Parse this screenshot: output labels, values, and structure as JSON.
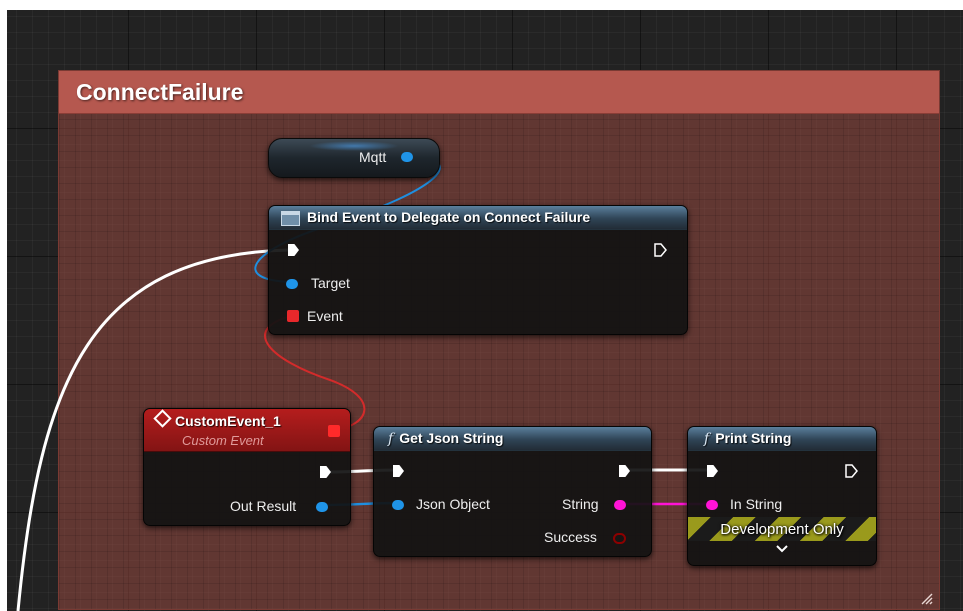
{
  "comment": {
    "title": "ConnectFailure",
    "color": "#b5584f"
  },
  "colors": {
    "exec": "#ffffff",
    "object_pin": "#1f94e8",
    "delegate_pin": "#e8282b",
    "string_pin": "#ff13d6",
    "bool_pin": "#8c0000",
    "function_header": "#2f4456",
    "event_header": "#a31a1a"
  },
  "mqtt_node": {
    "pin_label": "Mqtt",
    "icon": "object-pin-icon"
  },
  "bind_node": {
    "title": "Bind Event to Delegate on Connect Failure",
    "icon": "delegate-icon",
    "pins": {
      "target": "Target",
      "event": "Event"
    }
  },
  "custom_event_node": {
    "title": "CustomEvent_1",
    "subtitle": "Custom Event",
    "icon": "event-diamond-icon",
    "pins": {
      "out_result": "Out Result"
    }
  },
  "get_json_node": {
    "title": "Get Json String",
    "icon": "f",
    "pins": {
      "json_object": "Json Object",
      "string": "String",
      "success": "Success"
    }
  },
  "print_node": {
    "title": "Print String",
    "icon": "f",
    "pins": {
      "in_string": "In String"
    },
    "banner": "Development Only",
    "expand_icon": "chevron-down-icon"
  }
}
